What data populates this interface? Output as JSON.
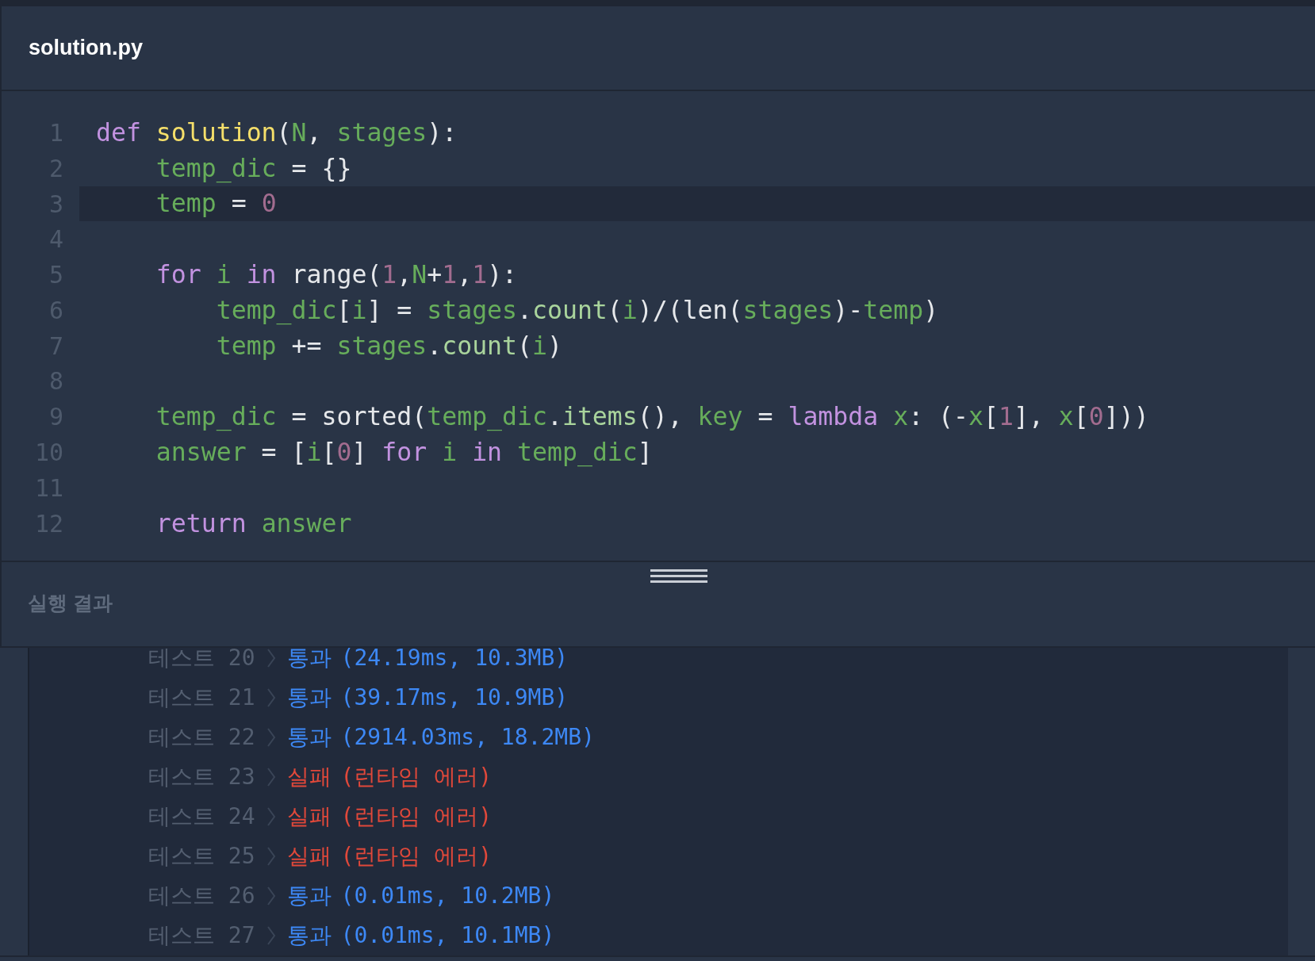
{
  "editor": {
    "title": "solution.py",
    "lines": [
      {
        "number": "1",
        "highlighted": false,
        "tokens": [
          {
            "kind": "keyword",
            "text": "def "
          },
          {
            "kind": "function",
            "text": "solution"
          },
          {
            "kind": "plain",
            "text": "("
          },
          {
            "kind": "variable",
            "text": "N"
          },
          {
            "kind": "plain",
            "text": ", "
          },
          {
            "kind": "variable",
            "text": "stages"
          },
          {
            "kind": "plain",
            "text": "):"
          }
        ]
      },
      {
        "number": "2",
        "highlighted": false,
        "tokens": [
          {
            "kind": "variable",
            "text": "    temp_dic"
          },
          {
            "kind": "plain",
            "text": " = {}"
          }
        ]
      },
      {
        "number": "3",
        "highlighted": true,
        "tokens": [
          {
            "kind": "variable",
            "text": "    temp"
          },
          {
            "kind": "plain",
            "text": " = "
          },
          {
            "kind": "number",
            "text": "0"
          }
        ]
      },
      {
        "number": "4",
        "highlighted": false
      },
      {
        "number": "5",
        "highlighted": false,
        "tokens": [
          {
            "kind": "keyword",
            "text": "    for "
          },
          {
            "kind": "variable",
            "text": "i "
          },
          {
            "kind": "keyword",
            "text": "in"
          },
          {
            "kind": "plain",
            "text": " range("
          },
          {
            "kind": "number",
            "text": "1"
          },
          {
            "kind": "plain",
            "text": ","
          },
          {
            "kind": "variable",
            "text": "N"
          },
          {
            "kind": "plain",
            "text": "+"
          },
          {
            "kind": "number",
            "text": "1"
          },
          {
            "kind": "plain",
            "text": ","
          },
          {
            "kind": "number",
            "text": "1"
          },
          {
            "kind": "plain",
            "text": "):"
          }
        ]
      },
      {
        "number": "6",
        "highlighted": false,
        "tokens": [
          {
            "kind": "variable",
            "text": "        temp_dic"
          },
          {
            "kind": "plain",
            "text": "["
          },
          {
            "kind": "variable",
            "text": "i"
          },
          {
            "kind": "plain",
            "text": "] = "
          },
          {
            "kind": "variable",
            "text": "stages"
          },
          {
            "kind": "plain",
            "text": "."
          },
          {
            "kind": "method",
            "text": "count"
          },
          {
            "kind": "plain",
            "text": "("
          },
          {
            "kind": "variable",
            "text": "i"
          },
          {
            "kind": "plain",
            "text": ")/(len("
          },
          {
            "kind": "variable",
            "text": "stages"
          },
          {
            "kind": "plain",
            "text": ")-"
          },
          {
            "kind": "variable",
            "text": "temp"
          },
          {
            "kind": "plain",
            "text": ")"
          }
        ]
      },
      {
        "number": "7",
        "highlighted": false,
        "tokens": [
          {
            "kind": "variable",
            "text": "        temp"
          },
          {
            "kind": "plain",
            "text": " += "
          },
          {
            "kind": "variable",
            "text": "stages"
          },
          {
            "kind": "plain",
            "text": "."
          },
          {
            "kind": "method",
            "text": "count"
          },
          {
            "kind": "plain",
            "text": "("
          },
          {
            "kind": "variable",
            "text": "i"
          },
          {
            "kind": "plain",
            "text": ")"
          }
        ]
      },
      {
        "number": "8",
        "highlighted": false
      },
      {
        "number": "9",
        "highlighted": false,
        "tokens": [
          {
            "kind": "variable",
            "text": "    temp_dic"
          },
          {
            "kind": "plain",
            "text": " = sorted("
          },
          {
            "kind": "variable",
            "text": "temp_dic"
          },
          {
            "kind": "plain",
            "text": "."
          },
          {
            "kind": "method",
            "text": "items"
          },
          {
            "kind": "plain",
            "text": "(), "
          },
          {
            "kind": "variable",
            "text": "key"
          },
          {
            "kind": "plain",
            "text": " = "
          },
          {
            "kind": "keyword",
            "text": "lambda "
          },
          {
            "kind": "variable",
            "text": "x"
          },
          {
            "kind": "plain",
            "text": ": (-"
          },
          {
            "kind": "variable",
            "text": "x"
          },
          {
            "kind": "plain",
            "text": "["
          },
          {
            "kind": "number",
            "text": "1"
          },
          {
            "kind": "plain",
            "text": "], "
          },
          {
            "kind": "variable",
            "text": "x"
          },
          {
            "kind": "plain",
            "text": "["
          },
          {
            "kind": "number",
            "text": "0"
          },
          {
            "kind": "plain",
            "text": "]))"
          }
        ]
      },
      {
        "number": "10",
        "highlighted": false,
        "tokens": [
          {
            "kind": "variable",
            "text": "    answer"
          },
          {
            "kind": "plain",
            "text": " = ["
          },
          {
            "kind": "variable",
            "text": "i"
          },
          {
            "kind": "plain",
            "text": "["
          },
          {
            "kind": "number",
            "text": "0"
          },
          {
            "kind": "plain",
            "text": "] "
          },
          {
            "kind": "keyword",
            "text": "for "
          },
          {
            "kind": "variable",
            "text": "i "
          },
          {
            "kind": "keyword",
            "text": "in "
          },
          {
            "kind": "variable",
            "text": "temp_dic"
          },
          {
            "kind": "plain",
            "text": "]"
          }
        ]
      },
      {
        "number": "11",
        "highlighted": false
      },
      {
        "number": "12",
        "highlighted": false,
        "tokens": [
          {
            "kind": "keyword",
            "text": "    return "
          },
          {
            "kind": "variable",
            "text": "answer"
          }
        ]
      }
    ]
  },
  "results": {
    "title": "실행 결과",
    "rows": [
      {
        "label": "테스트 20",
        "passed": true,
        "result": "통과",
        "detail": "(24.19ms, 10.3MB)"
      },
      {
        "label": "테스트 21",
        "passed": true,
        "result": "통과",
        "detail": "(39.17ms, 10.9MB)"
      },
      {
        "label": "테스트 22",
        "passed": true,
        "result": "통과",
        "detail": "(2914.03ms, 18.2MB)"
      },
      {
        "label": "테스트 23",
        "passed": false,
        "result": "실패",
        "detail": "(런타임 에러)"
      },
      {
        "label": "테스트 24",
        "passed": false,
        "result": "실패",
        "detail": "(런타임 에러)"
      },
      {
        "label": "테스트 25",
        "passed": false,
        "result": "실패",
        "detail": "(런타임 에러)"
      },
      {
        "label": "테스트 26",
        "passed": true,
        "result": "통과",
        "detail": "(0.01ms, 10.2MB)"
      },
      {
        "label": "테스트 27",
        "passed": true,
        "result": "통과",
        "detail": "(0.01ms, 10.1MB)"
      }
    ]
  }
}
